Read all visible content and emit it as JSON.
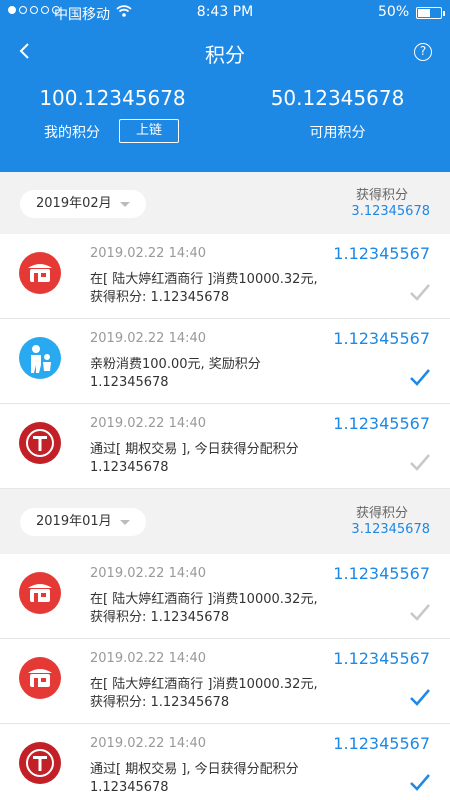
{
  "status_bar": {
    "carrier": "中国移动",
    "time": "8:43 PM",
    "battery": "50%",
    "battery_level": 0.5
  },
  "nav": {
    "title": "积分",
    "help_glyph": "?"
  },
  "summary": {
    "my_points": "100.12345678",
    "my_points_label": "我的积分",
    "chain_button": "上链",
    "available_points": "50.12345678",
    "available_label": "可用积分"
  },
  "sections": [
    {
      "month": "2019年02月",
      "earned_label": "获得积分",
      "earned_value": "3.12345678",
      "records": [
        {
          "icon": "shop-icon",
          "date": "2019.02.22  14:40",
          "amount": "1.12345567",
          "line1": "在[ 陆大婷红酒商行 ]消费10000.32元,",
          "line2": "获得积分: 1.12345678",
          "status": "pending"
        },
        {
          "icon": "family-icon",
          "date": "2019.02.22  14:40",
          "amount": "1.12345567",
          "line1": "亲粉消费100.00元, 奖励积分",
          "line2": "1.12345678",
          "status": "confirmed"
        },
        {
          "icon": "tmall-icon",
          "date": "2019.02.22  14:40",
          "amount": "1.12345567",
          "line1": "通过[ 期权交易 ], 今日获得分配积分",
          "line2": "1.12345678",
          "status": "pending"
        }
      ]
    },
    {
      "month": "2019年01月",
      "earned_label": "获得积分",
      "earned_value": "3.12345678",
      "records": [
        {
          "icon": "shop-icon",
          "date": "2019.02.22  14:40",
          "amount": "1.12345567",
          "line1": "在[ 陆大婷红酒商行 ]消费10000.32元,",
          "line2": "获得积分: 1.12345678",
          "status": "pending"
        },
        {
          "icon": "shop-icon",
          "date": "2019.02.22  14:40",
          "amount": "1.12345567",
          "line1": "在[ 陆大婷红酒商行 ]消费10000.32元,",
          "line2": "获得积分: 1.12345678",
          "status": "confirmed"
        },
        {
          "icon": "tmall-icon",
          "date": "2019.02.22  14:40",
          "amount": "1.12345567",
          "line1": "通过[ 期权交易 ], 今日获得分配积分",
          "line2": "1.12345678",
          "status": "confirmed"
        }
      ]
    }
  ],
  "colors": {
    "accent": "#1e88e5",
    "confirmed": "#1e88e5",
    "pending": "#c8c8c8"
  }
}
